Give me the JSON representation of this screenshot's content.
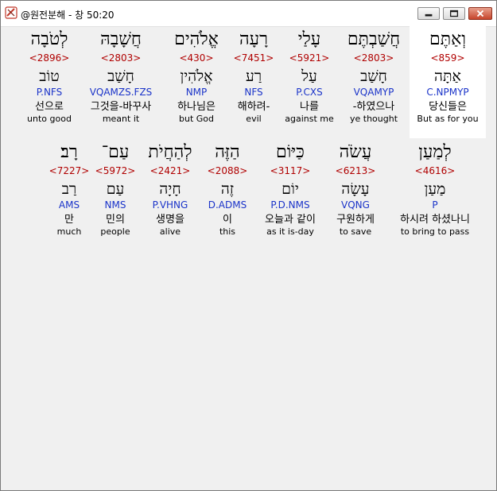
{
  "window": {
    "title": "@원전분해 - 창 50:20"
  },
  "rows": [
    {
      "words": [
        {
          "hebrew": "לְטֹבָה",
          "strongs": "<2896>",
          "lemma": "טוֹב",
          "parse": "P.NFS",
          "korean": "선으로",
          "english": "unto good"
        },
        {
          "hebrew": "חֲשָׁבָהּ",
          "strongs": "<2803>",
          "lemma": "חָשַׁב",
          "parse": "VQAMZS.FZS",
          "korean": "그것을-바꾸사",
          "english": "meant it"
        },
        {
          "hebrew": "אֱלֹהִים",
          "strongs": "<430>",
          "lemma": "אֱלֹהִין",
          "parse": "NMP",
          "korean": "하나님은",
          "english": "but God"
        },
        {
          "hebrew": "רָעָה",
          "strongs": "<7451>",
          "lemma": "רַע",
          "parse": "NFS",
          "korean": "해하려-",
          "english": "evil"
        },
        {
          "hebrew": "עָלַי",
          "strongs": "<5921>",
          "lemma": "עַל",
          "parse": "P.CXS",
          "korean": "나를",
          "english": "against me"
        },
        {
          "hebrew": "חֲשַׁבְתֶּם",
          "strongs": "<2803>",
          "lemma": "חָשַׁב",
          "parse": "VQAMYP",
          "korean": "-하였으나",
          "english": "ye thought"
        },
        {
          "hebrew": "וְאַתֶּם",
          "strongs": "<859>",
          "lemma": "אַתָּה",
          "parse": "C.NPMYP",
          "korean": "당신들은",
          "english": "But as for you",
          "selected": true
        }
      ]
    },
    {
      "words": [
        {
          "hebrew": "רָב׃",
          "strongs": "<7227>",
          "lemma": "רַב",
          "parse": "AMS",
          "korean": "만",
          "english": "much"
        },
        {
          "hebrew": "עַם־",
          "strongs": "<5972>",
          "lemma": "עַם",
          "parse": "NMS",
          "korean": "민의",
          "english": "people"
        },
        {
          "hebrew": "לְהַחֲיֹת",
          "strongs": "<2421>",
          "lemma": "חָיָה",
          "parse": "P.VHNG",
          "korean": "생명을",
          "english": "alive"
        },
        {
          "hebrew": "הַזֶּה",
          "strongs": "<2088>",
          "lemma": "זֶה",
          "parse": "D.ADMS",
          "korean": "이",
          "english": "this"
        },
        {
          "hebrew": "כַּיּוֹם",
          "strongs": "<3117>",
          "lemma": "יוֹם",
          "parse": "P.D.NMS",
          "korean": "오늘과 같이",
          "english": "as it is-day"
        },
        {
          "hebrew": "עֲשֹׂה",
          "strongs": "<6213>",
          "lemma": "עָשָׂה",
          "parse": "VQNG",
          "korean": "구원하게",
          "english": "to save"
        },
        {
          "hebrew": "לְמַעַן",
          "strongs": "<4616>",
          "lemma": "מַעַן",
          "parse": "P",
          "korean": "하시려 하셨나니",
          "english": "to bring to pass"
        }
      ]
    }
  ],
  "colors": {
    "strongs": "#b00000",
    "parse": "#1a33c9",
    "selection_bg": "#ffffff"
  }
}
